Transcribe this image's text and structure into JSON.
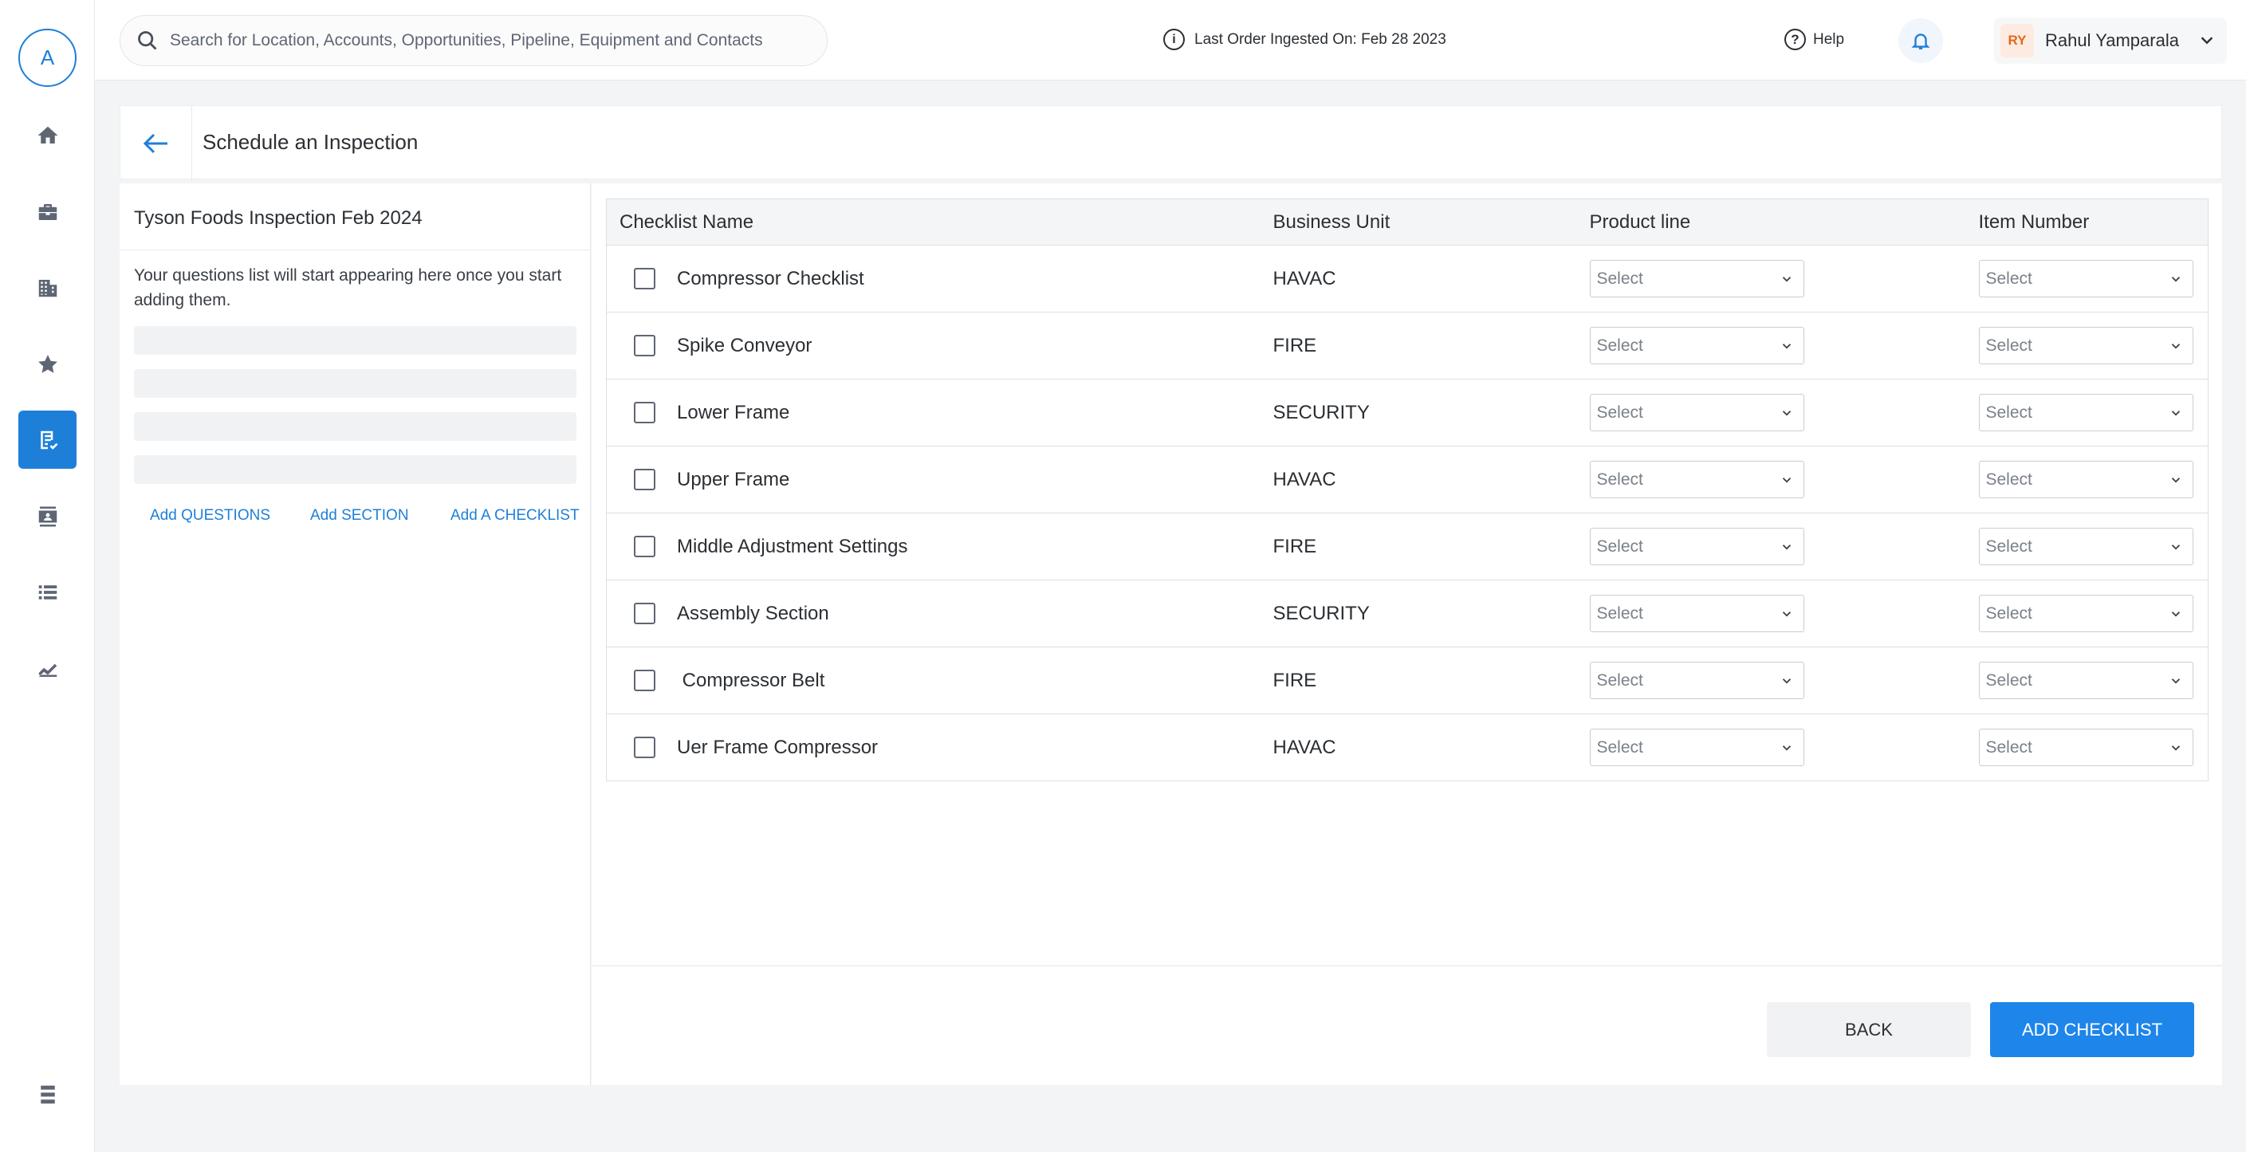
{
  "sidebar": {
    "logo_letter": "A",
    "nav_items": [
      "home",
      "briefcase",
      "building",
      "star",
      "checklist",
      "contacts",
      "list",
      "chart"
    ],
    "active_item": "checklist"
  },
  "topbar": {
    "search_placeholder": "Search for Location, Accounts, Opportunities, Pipeline, Equipment and Contacts",
    "last_order": "Last Order Ingested On: Feb 28 2023",
    "help_label": "Help",
    "user_initials": "RY",
    "user_name": "Rahul Yamparala"
  },
  "page": {
    "title": "Schedule an Inspection"
  },
  "left_panel": {
    "inspection_name": "Tyson Foods Inspection Feb 2024",
    "empty_message": "Your questions list will start appearing here once you start adding them.",
    "actions": {
      "add_questions": "Add QUESTIONS",
      "add_section": "Add SECTION",
      "add_checklist": "Add A CHECKLIST"
    }
  },
  "table": {
    "columns": {
      "name": "Checklist Name",
      "business_unit": "Business Unit",
      "product_line": "Product line",
      "item_number": "Item Number"
    },
    "rows": [
      {
        "name": "Compressor Checklist",
        "business_unit": "HAVAC",
        "product_line": "Select",
        "item_number": "Select"
      },
      {
        "name": "Spike Conveyor",
        "business_unit": "FIRE",
        "product_line": "Select",
        "item_number": "Select"
      },
      {
        "name": "Lower Frame",
        "business_unit": "SECURITY",
        "product_line": "Select",
        "item_number": "Select"
      },
      {
        "name": "Upper Frame",
        "business_unit": "HAVAC",
        "product_line": "Select",
        "item_number": "Select"
      },
      {
        "name": "Middle Adjustment Settings",
        "business_unit": "FIRE",
        "product_line": "Select",
        "item_number": "Select"
      },
      {
        "name": "Assembly Section",
        "business_unit": "SECURITY",
        "product_line": "Select",
        "item_number": "Select"
      },
      {
        "name": " Compressor Belt",
        "business_unit": "FIRE",
        "product_line": "Select",
        "item_number": "Select"
      },
      {
        "name": "Uer Frame Compressor",
        "business_unit": "HAVAC",
        "product_line": "Select",
        "item_number": "Select"
      }
    ]
  },
  "footer": {
    "back_label": "BACK",
    "add_label": "ADD CHECKLIST"
  },
  "colors": {
    "accent": "#1e7fd9",
    "primary_button": "#1e85ea"
  }
}
